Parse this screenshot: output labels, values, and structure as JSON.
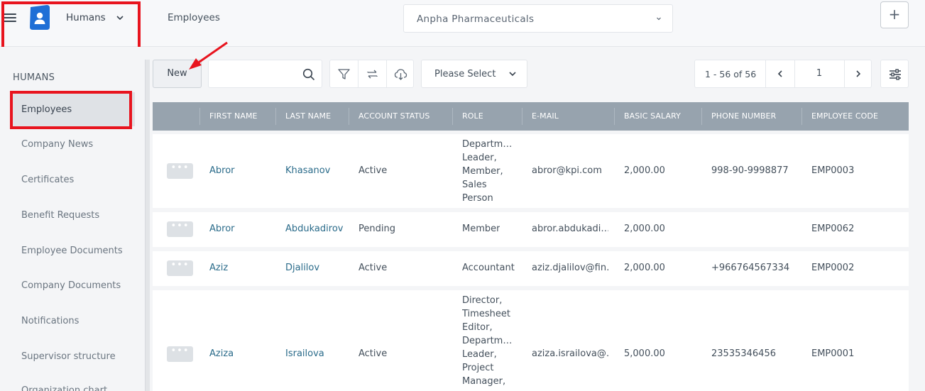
{
  "header": {
    "app_name": "Humans",
    "breadcrumb": "Employees",
    "company": "Anpha Pharmaceuticals",
    "add_label": "+"
  },
  "sidebar": {
    "heading": "HUMANS",
    "items": [
      {
        "label": "Employees",
        "active": true
      },
      {
        "label": "Company News"
      },
      {
        "label": "Certificates"
      },
      {
        "label": "Benefit Requests"
      },
      {
        "label": "Employee Documents"
      },
      {
        "label": "Company Documents"
      },
      {
        "label": "Notifications"
      },
      {
        "label": "Supervisor structure"
      },
      {
        "label": "Organization chart"
      }
    ]
  },
  "toolbar": {
    "new_label": "New",
    "search_placeholder": "",
    "filter_select": "Please Select",
    "pager": {
      "range": "1 - 56 of 56",
      "page": "1"
    }
  },
  "table": {
    "columns": [
      "FIRST NAME",
      "LAST NAME",
      "ACCOUNT STATUS",
      "ROLE",
      "E-MAIL",
      "BASIC SALARY",
      "PHONE NUMBER",
      "EMPLOYEE CODE"
    ],
    "rows": [
      {
        "actions": "•••",
        "first_name": "Abror",
        "last_name": "Khasanov",
        "status": "Active",
        "role_lines": [
          "Departme…",
          "Leader,",
          "Member,",
          "Sales",
          "Person"
        ],
        "email": "abror@kpi.com",
        "salary": "2,000.00",
        "phone": "998-90-9998877",
        "code": "EMP0003"
      },
      {
        "actions": "•••",
        "first_name": "Abror",
        "last_name": "Abdukadirov",
        "status": "Pending",
        "role_lines": [
          "Member"
        ],
        "email": "abror.abdukadi…",
        "salary": "2,000.00",
        "phone": "",
        "code": "EMP0062"
      },
      {
        "actions": "•••",
        "first_name": "Aziz",
        "last_name": "Djalilov",
        "status": "Active",
        "role_lines": [
          "Accountant"
        ],
        "email": "aziz.djalilov@fin…",
        "salary": "2,000.00",
        "phone": "+966764567334",
        "code": "EMP0002"
      },
      {
        "actions": "•••",
        "first_name": "Aziza",
        "last_name": "Israilova",
        "status": "Active",
        "role_lines": [
          "Director,",
          "Timesheet",
          "Editor,",
          "Departme…",
          "Leader,",
          "Project",
          "Manager,"
        ],
        "email": "aziza.israilova@…",
        "salary": "5,000.00",
        "phone": "23535346456",
        "code": "EMP0001"
      }
    ]
  },
  "colors": {
    "table_header": "#97a3ae",
    "link": "#2a6b8a",
    "annotation_red": "#e8141e",
    "logo_blue": "#1f6fd6"
  }
}
